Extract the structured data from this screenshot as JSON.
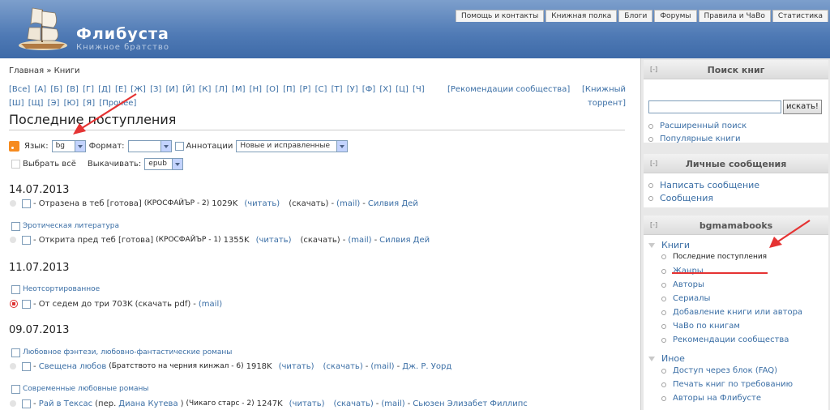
{
  "header": {
    "site_name": "Флибуста",
    "slogan": "Книжное братство",
    "nav": [
      "Помощь и контакты",
      "Книжная полка",
      "Блоги",
      "Форумы",
      "Правила и ЧаВо",
      "Статистика"
    ]
  },
  "breadcrumb": "Главная » Книги",
  "alphabet": [
    "[Все]",
    "[А]",
    "[Б]",
    "[В]",
    "[Г]",
    "[Д]",
    "[Е]",
    "[Ж]",
    "[З]",
    "[И]",
    "[Й]",
    "[К]",
    "[Л]",
    "[М]",
    "[Н]",
    "[О]",
    "[П]",
    "[Р]",
    "[С]",
    "[Т]",
    "[У]",
    "[Ф]",
    "[Х]",
    "[Ц]",
    "[Ч]",
    "[Ш]",
    "[Щ]",
    "[Э]",
    "[Ю]",
    "[Я]",
    "[Прочее]"
  ],
  "recommendations": "[Рекомендации сообщества]",
  "torrent": "[Книжный торрент]",
  "page_title": "Последние поступления",
  "filters": {
    "lang_label": "Язык:",
    "lang_value": "bg",
    "format_label": "Формат:",
    "format_value": "",
    "annotations_label": "Аннотации",
    "sort_value": "Новые и исправленные",
    "select_all": "Выбрать всё",
    "download_label": "Выкачивать:",
    "download_value": "epub"
  },
  "dates": [
    "14.07.2013",
    "11.07.2013",
    "09.07.2013"
  ],
  "genres": [
    "Эротическая литература",
    "Неотсортированное",
    "Любовное фэнтези, любовно-фантастические романы",
    "Современные любовные романы"
  ],
  "books": [
    {
      "prefix": "- ",
      "title": "Отразена в теб [готова]",
      "series": "(КРОСФАЙЪР - 2)",
      "size": "1029K",
      "read": "(читать)",
      "download": "(скачать)",
      "mail": "(mail)",
      "author": "Силвия Дей"
    },
    {
      "prefix": "- ",
      "title": "Открита пред теб [готова]",
      "series": "(КРОСФАЙЪР - 1)",
      "size": "1355K",
      "read": "(читать)",
      "download": "(скачать)",
      "mail": "(mail)",
      "author": "Силвия Дей"
    },
    {
      "prefix": "- ",
      "title": "От седем до три",
      "size": "703K",
      "download": "(скачать pdf)",
      "mail": "(mail)"
    },
    {
      "prefix": "- ",
      "title": "Свещена любов",
      "series": "(Братството на черния кинжал - 6)",
      "size": "1918K",
      "read": "(читать)",
      "download": "(скачать)",
      "mail": "(mail)",
      "author": "Дж. Р. Уорд"
    },
    {
      "prefix": "- ",
      "title": "Рай в Тексас",
      "translator_prefix": "(пер.",
      "translator": "Диана Кутева",
      "translator_suffix": ")",
      "series": "(Чикаго старс - 2)",
      "size": "1247K",
      "read": "(читать)",
      "download": "(скачать)",
      "mail": "(mail)",
      "author": "Сьюзен Элизабет Филлипс"
    }
  ],
  "sidebar": {
    "toggle": "[-]",
    "search_title": "Поиск книг",
    "search_button": "искать!",
    "search_links": [
      "Расширенный поиск",
      "Популярные книги"
    ],
    "messages_title": "Личные сообщения",
    "message_links": [
      "Написать сообщение",
      "Сообщения"
    ],
    "user_title": "bgmamabooks",
    "books_label": "Книги",
    "books_items": [
      "Последние поступления",
      "Жанры",
      "Авторы",
      "Сериалы",
      "Добавление книги или автора",
      "ЧаВо по книгам",
      "Рекомендации сообщества"
    ],
    "other_label": "Иное",
    "other_items": [
      "Доступ через блок (FAQ)",
      "Печать книг по требованию",
      "Авторы на Флибусте"
    ]
  },
  "colors": {
    "accent": "#3a6ea5",
    "header": "#4f7ab5",
    "arrow": "#e53333"
  }
}
